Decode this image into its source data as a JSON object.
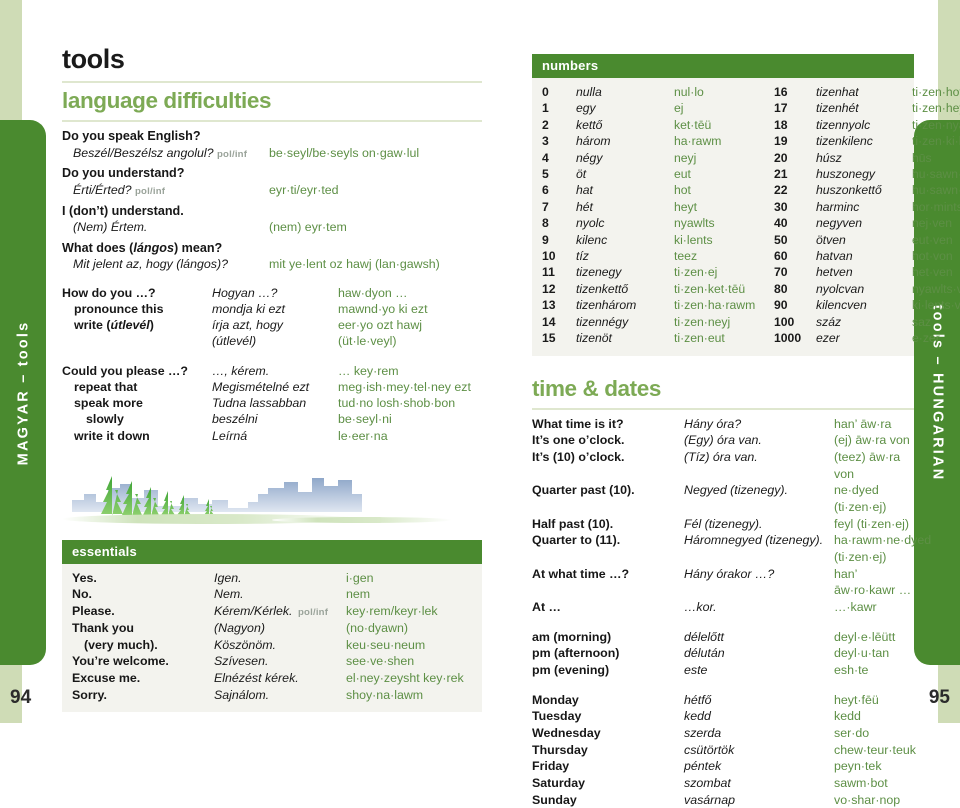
{
  "spread": {
    "left_tab_label": "MAGYAR – tools",
    "right_tab_label": "tools – HUNGARIAN",
    "left_folio": "94",
    "right_folio": "95",
    "accent_green": "#4a8a2f",
    "heading_green": "#7daa55",
    "pron_green": "#5d8f45",
    "band_green": "#cfdcb6",
    "panel_bg": "#f3f3ee"
  },
  "left_page": {
    "running_title": "tools",
    "section_title": "language difficulties",
    "polinf": "pol/inf",
    "phrases": [
      {
        "en": "Do you speak English?",
        "hu": "Beszél/Beszélsz angolul?",
        "tag": "pol/inf",
        "pr": "be·seyl/be·seyls on·gaw·lul"
      },
      {
        "en": "Do you understand?",
        "hu": "Érti/Érted?",
        "tag": "pol/inf",
        "pr": "eyr·ti/eyr·ted"
      },
      {
        "en": "I (don’t) understand.",
        "hu": "(Nem) Értem.",
        "tag": "",
        "pr": "(nem) eyr·tem"
      },
      {
        "en": "What does (lángos) mean?",
        "hu": "Mit jelent az, hogy (lángos)?",
        "tag": "",
        "pr": "mit ye·lent oz hawj (lan·gawsh)"
      }
    ],
    "how_do_you": [
      {
        "en": "How do you …?",
        "hu": "Hogyan …?",
        "pr": "haw·dyon …",
        "indent": 0
      },
      {
        "en": "pronounce this",
        "hu": "mondja ki ezt",
        "pr": "mawnd·yo ki ezt",
        "indent": 1
      },
      {
        "en": "write (útlevél)",
        "hu": "írja azt, hogy",
        "pr": "eer·yo ozt hawj",
        "indent": 1
      },
      {
        "en": "",
        "hu": "(útlevél)",
        "pr": "(üt·le·veyl)",
        "indent": 1
      }
    ],
    "could_you_please": [
      {
        "en": "Could you please …?",
        "hu": "…, kérem.",
        "pr": "… key·rem",
        "indent": 0
      },
      {
        "en": "repeat that",
        "hu": "Megismételné ezt",
        "pr": "meg·ish·mey·tel·ney ezt",
        "indent": 1
      },
      {
        "en": "speak more",
        "hu": "Tudna lassabban",
        "pr": "tud·no losh·shob·bon",
        "indent": 1
      },
      {
        "en": "slowly",
        "hu": "beszélni",
        "pr": "be·seyl·ni",
        "indent": 2
      },
      {
        "en": "write it down",
        "hu": "Leírná",
        "pr": "le·eer·na",
        "indent": 1
      }
    ],
    "essentials": {
      "heading": "essentials",
      "rows": [
        {
          "en": "Yes.",
          "hu": "Igen.",
          "tag": "",
          "pr": "i·gen"
        },
        {
          "en": "No.",
          "hu": "Nem.",
          "tag": "",
          "pr": "nem"
        },
        {
          "en": "Please.",
          "hu": "Kérem/Kérlek.",
          "tag": "pol/inf",
          "pr": "key·rem/keyr·lek"
        },
        {
          "en": "Thank you",
          "hu": "(Nagyon)",
          "tag": "",
          "pr": "(no·dyawn)"
        },
        {
          "en": "(very much).",
          "hu": "Köszönöm.",
          "tag": "",
          "pr": "keu·seu·neum",
          "indent": 1
        },
        {
          "en": "You’re welcome.",
          "hu": "Szívesen.",
          "tag": "",
          "pr": "see·ve·shen"
        },
        {
          "en": "Excuse me.",
          "hu": "Elnézést kérek.",
          "tag": "",
          "pr": "el·ney·zeysht key·rek"
        },
        {
          "en": "Sorry.",
          "hu": "Sajnálom.",
          "tag": "",
          "pr": "shoy·na·lawm"
        }
      ]
    },
    "illustration_name": "cityscape-with-trees-illustration"
  },
  "right_page": {
    "numbers": {
      "heading": "numbers",
      "col_a": [
        {
          "n": "0",
          "w": "nulla",
          "p": "nul·lo"
        },
        {
          "n": "1",
          "w": "egy",
          "p": "ej"
        },
        {
          "n": "2",
          "w": "kettő",
          "p": "ket·tēü"
        },
        {
          "n": "3",
          "w": "három",
          "p": "ha·rawm"
        },
        {
          "n": "4",
          "w": "négy",
          "p": "neyj"
        },
        {
          "n": "5",
          "w": "öt",
          "p": "eut"
        },
        {
          "n": "6",
          "w": "hat",
          "p": "hot"
        },
        {
          "n": "7",
          "w": "hét",
          "p": "heyt"
        },
        {
          "n": "8",
          "w": "nyolc",
          "p": "nyawlts"
        },
        {
          "n": "9",
          "w": "kilenc",
          "p": "ki·lents"
        },
        {
          "n": "10",
          "w": "tíz",
          "p": "teez"
        },
        {
          "n": "11",
          "w": "tizenegy",
          "p": "ti·zen·ej"
        },
        {
          "n": "12",
          "w": "tizenkettő",
          "p": "ti·zen·ket·tēü"
        },
        {
          "n": "13",
          "w": "tizenhárom",
          "p": "ti·zen·ha·rawm"
        },
        {
          "n": "14",
          "w": "tizennégy",
          "p": "ti·zen·neyj"
        },
        {
          "n": "15",
          "w": "tizenöt",
          "p": "ti·zen·eut"
        }
      ],
      "col_b": [
        {
          "n": "16",
          "w": "tizenhat",
          "p": "ti·zen·hot"
        },
        {
          "n": "17",
          "w": "tizenhét",
          "p": "ti·zen·heyt"
        },
        {
          "n": "18",
          "w": "tizennyolc",
          "p": "ti·zen·nyawlts"
        },
        {
          "n": "19",
          "w": "tizenkilenc",
          "p": "ti·zen·ki·lents"
        },
        {
          "n": "20",
          "w": "húsz",
          "p": "hūs"
        },
        {
          "n": "21",
          "w": "huszonegy",
          "p": "hu·sawn·ej"
        },
        {
          "n": "22",
          "w": "huszonkettő",
          "p": "hu·sawn·ket·tēü"
        },
        {
          "n": "30",
          "w": "harminc",
          "p": "hor·mints"
        },
        {
          "n": "40",
          "w": "negyven",
          "p": "nej·ven"
        },
        {
          "n": "50",
          "w": "ötven",
          "p": "eut·ven"
        },
        {
          "n": "60",
          "w": "hatvan",
          "p": "hot·von"
        },
        {
          "n": "70",
          "w": "hetven",
          "p": "het·ven"
        },
        {
          "n": "80",
          "w": "nyolcvan",
          "p": "nyawlts·von"
        },
        {
          "n": "90",
          "w": "kilencven",
          "p": "ki·lents·ven"
        },
        {
          "n": "100",
          "w": "száz",
          "p": "saz"
        },
        {
          "n": "1000",
          "w": "ezer",
          "p": "e·zer"
        }
      ]
    },
    "time_dates": {
      "heading": "time & dates",
      "times": [
        {
          "en": "What time is it?",
          "hu": "Hány óra?",
          "pr": "han’ āw·ra"
        },
        {
          "en": "It’s one o’clock.",
          "hu": "(Egy) óra van.",
          "pr": "(ej) āw·ra von"
        },
        {
          "en": "It’s (10) o’clock.",
          "hu": "(Tíz) óra van.",
          "pr": "(teez) āw·ra von"
        },
        {
          "en": "Quarter past (10).",
          "hu": "Negyed (tizenegy).",
          "pr": "ne·dyed (ti·zen·ej)"
        },
        {
          "en": "Half past (10).",
          "hu": "Fél (tizenegy).",
          "pr": "feyl (ti·zen·ej)"
        },
        {
          "en": "Quarter to (11).",
          "hu": "Háromnegyed (tizenegy).",
          "pr": "ha·rawm·ne·dyed (ti·zen·ej)"
        },
        {
          "en": "At what time …?",
          "hu": "Hány órakor …?",
          "pr": "han’ āw·ro·kawr …"
        },
        {
          "en": "At …",
          "hu": "…kor.",
          "pr": "…·kawr"
        }
      ],
      "dayparts": [
        {
          "en": "am (morning)",
          "hu": "délelőtt",
          "pr": "deyl·e·lēütt"
        },
        {
          "en": "pm (afternoon)",
          "hu": "délután",
          "pr": "deyl·u·tan"
        },
        {
          "en": "pm (evening)",
          "hu": "este",
          "pr": "esh·te"
        }
      ],
      "days": [
        {
          "en": "Monday",
          "hu": "hétfő",
          "pr": "heyt·fēü"
        },
        {
          "en": "Tuesday",
          "hu": "kedd",
          "pr": "kedd"
        },
        {
          "en": "Wednesday",
          "hu": "szerda",
          "pr": "ser·do"
        },
        {
          "en": "Thursday",
          "hu": "csütörtök",
          "pr": "chew·teur·teuk"
        },
        {
          "en": "Friday",
          "hu": "péntek",
          "pr": "peyn·tek"
        },
        {
          "en": "Saturday",
          "hu": "szombat",
          "pr": "sawm·bot"
        },
        {
          "en": "Sunday",
          "hu": "vasárnap",
          "pr": "vo·shar·nop"
        }
      ]
    }
  }
}
